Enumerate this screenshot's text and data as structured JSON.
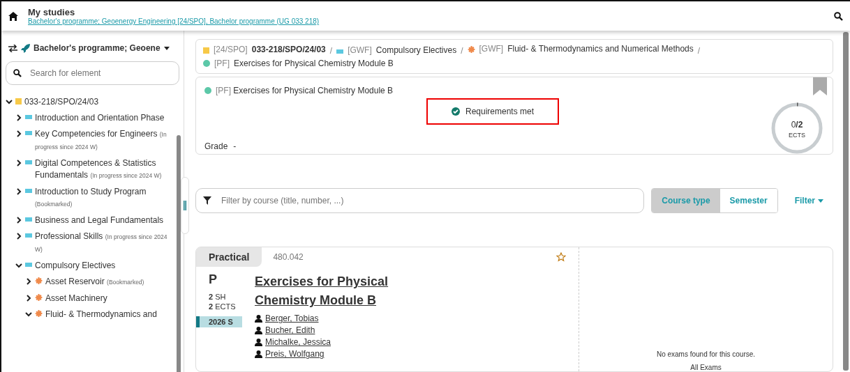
{
  "header": {
    "title": "My studies",
    "subtitle": "Bachelor's programme; Geoenergy Engineering [24/SPO], Bachelor programme (UG 033 218)"
  },
  "sidebar": {
    "programme": "Bachelor's programme; Geoene",
    "search": {
      "placeholder": "Search for element"
    },
    "tree": [
      {
        "label": "033-218/SPO/24/03",
        "kind": "square",
        "color": "#f7c948",
        "expanded": true,
        "children": [
          {
            "label": "Introduction and Orientation Phase",
            "kind": "bar",
            "color": "#5bc8e0",
            "expanded": false
          },
          {
            "label": "Key Competencies for Engineers",
            "note": "(In progress since 2024 W)",
            "kind": "bar",
            "color": "#5bc8e0",
            "expanded": false
          },
          {
            "label": "Digital Competences & Statistics Fundamentals",
            "note": "(In progress since 2024 W)",
            "kind": "bar",
            "color": "#5bc8e0",
            "expanded": false
          },
          {
            "label": "Introduction to Study Program",
            "note": "(Bookmarked)",
            "kind": "bar",
            "color": "#5bc8e0",
            "expanded": false
          },
          {
            "label": "Business and Legal Fundamentals",
            "kind": "bar",
            "color": "#5bc8e0",
            "expanded": false
          },
          {
            "label": "Professional Skills",
            "note": "(In progress since 2024 W)",
            "kind": "bar",
            "color": "#5bc8e0",
            "expanded": false
          },
          {
            "label": "Compulsory Electives",
            "kind": "bar",
            "color": "#5bc8e0",
            "expanded": true,
            "children": [
              {
                "label": "Asset Reservoir",
                "note": "(Bookmarked)",
                "kind": "gear",
                "color": "#f08a4b",
                "expanded": false
              },
              {
                "label": "Asset Machinery",
                "kind": "gear",
                "color": "#f08a4b",
                "expanded": false
              },
              {
                "label": "Fluid- & Thermodynamics and",
                "kind": "gear",
                "color": "#f08a4b",
                "expanded": true
              }
            ]
          }
        ]
      }
    ]
  },
  "breadcrumb_separator": "/",
  "breadcrumb": [
    {
      "tag": "[24/SPO]",
      "label": "033-218/SPO/24/03",
      "kind": "square",
      "color": "#f7c948"
    },
    {
      "tag": "[GWF]",
      "label": "Compulsory Electives",
      "kind": "bar",
      "color": "#5bc8e0"
    },
    {
      "tag": "[GWF]",
      "label": "Fluid- & Thermodynamics and Numerical Methods",
      "kind": "gear",
      "color": "#f08a4b"
    },
    {
      "tag": "[PF]",
      "label": "Exercises for Physical Chemistry Module B",
      "kind": "dot",
      "color": "#5cc8a8"
    }
  ],
  "detail": {
    "tag": "[PF]",
    "title": "Exercises for Physical Chemistry Module B",
    "color": "#5cc8a8",
    "status": "Requirements met",
    "grade_label": "Grade",
    "grade": "-",
    "ects": {
      "earned": "0",
      "total": "/2",
      "unit": "ECTS",
      "level": 0
    }
  },
  "filter": {
    "placeholder": "Filter by course (title, number, ...)",
    "views": [
      {
        "label": "Course type",
        "selected": true
      },
      {
        "label": "Semester",
        "selected": false
      }
    ],
    "menu": "Filter"
  },
  "course": {
    "type": "Practical",
    "number": "480.042",
    "code": "P",
    "sh": {
      "value": "2",
      "unit": "SH"
    },
    "ects": {
      "value": "2",
      "unit": "ECTS"
    },
    "semester": "2026 S",
    "title": "Exercises for Physical Chemistry Module B",
    "lecturers": [
      "Berger, Tobias",
      "Bucher, Edith",
      "Michalke, Jessica",
      "Preis, Wolfgang"
    ],
    "exams_message": "No exams found for this course.",
    "exams_link": "All Exams"
  }
}
